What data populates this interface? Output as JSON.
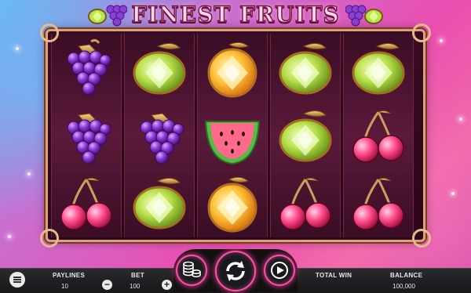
{
  "title": "FINEST FRUITS",
  "reels": [
    [
      "grapes",
      "grapes",
      "cherries"
    ],
    [
      "lemon",
      "grapes",
      "lemon"
    ],
    [
      "orange",
      "watermelon",
      "orange"
    ],
    [
      "lemon",
      "lemon",
      "cherries"
    ],
    [
      "lemon",
      "cherries",
      "cherries"
    ]
  ],
  "bottom_bar": {
    "paylines_label": "PAYLINES",
    "paylines_value": "10",
    "bet_label": "BET",
    "bet_value": "100",
    "total_win_label": "TOTAL WIN",
    "total_win_value": "",
    "balance_label": "BALANCE",
    "balance_value": "100,000",
    "decrease_symbol": "−",
    "increase_symbol": "+"
  },
  "controls": {
    "coins_icon": "coin-stack-icon",
    "spin_icon": "spin-arrows-icon",
    "autoplay_icon": "play-circle-icon",
    "menu_icon": "hamburger-menu-icon"
  },
  "colors": {
    "accent": "#ff4fa8",
    "frame": "#d9a37a",
    "reel_bg": "#4a1230"
  }
}
